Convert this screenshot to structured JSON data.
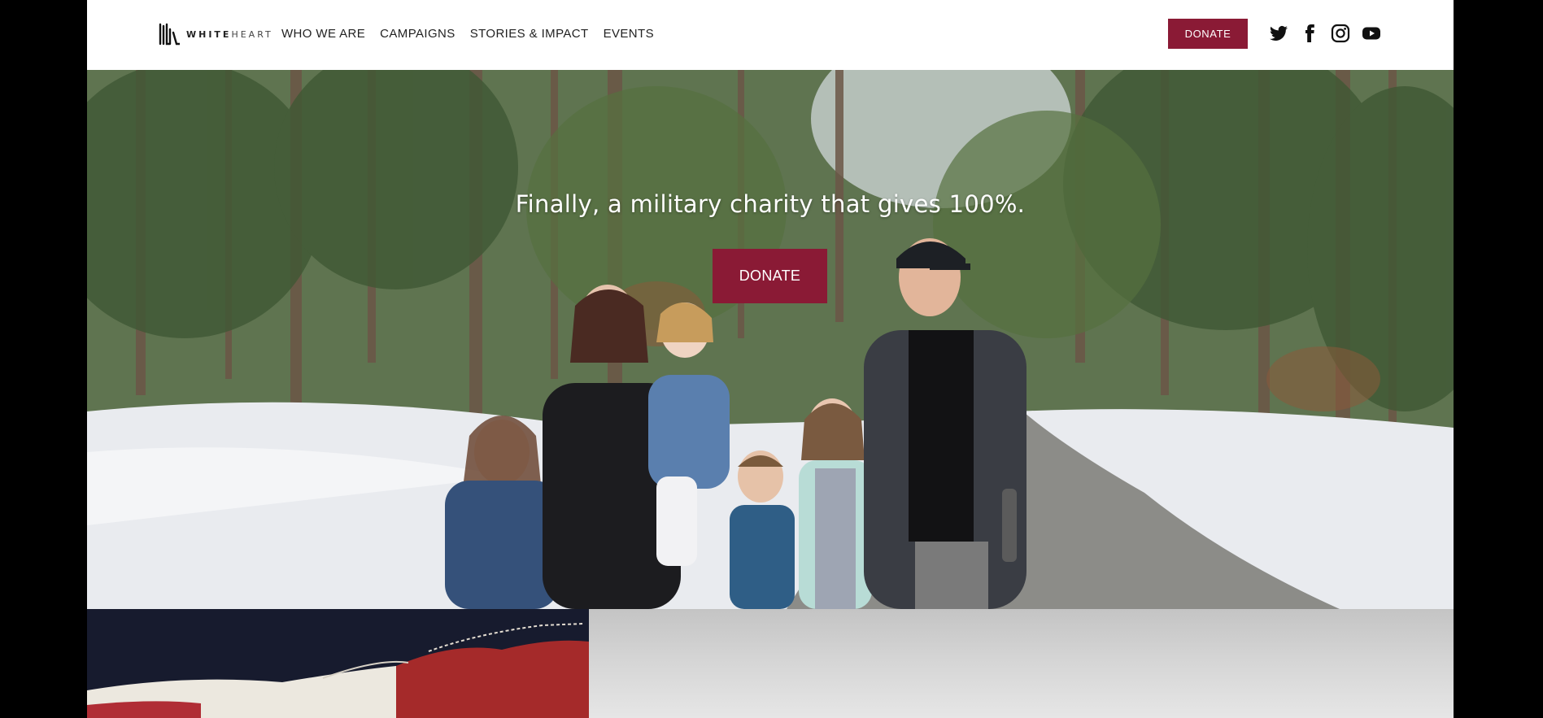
{
  "brand": {
    "logo_text_bold": "WHITE",
    "logo_text_light": "HEART",
    "accent_color": "#8a1a35"
  },
  "nav": {
    "items": [
      {
        "label": "WHO WE ARE"
      },
      {
        "label": "CAMPAIGNS"
      },
      {
        "label": "STORIES & IMPACT"
      },
      {
        "label": "EVENTS"
      }
    ]
  },
  "header": {
    "donate_label": "DONATE",
    "social_icons": [
      "twitter-icon",
      "facebook-icon",
      "instagram-icon",
      "youtube-icon"
    ]
  },
  "hero": {
    "headline": "Finally, a military charity that gives 100%.",
    "donate_label": "DONATE"
  }
}
